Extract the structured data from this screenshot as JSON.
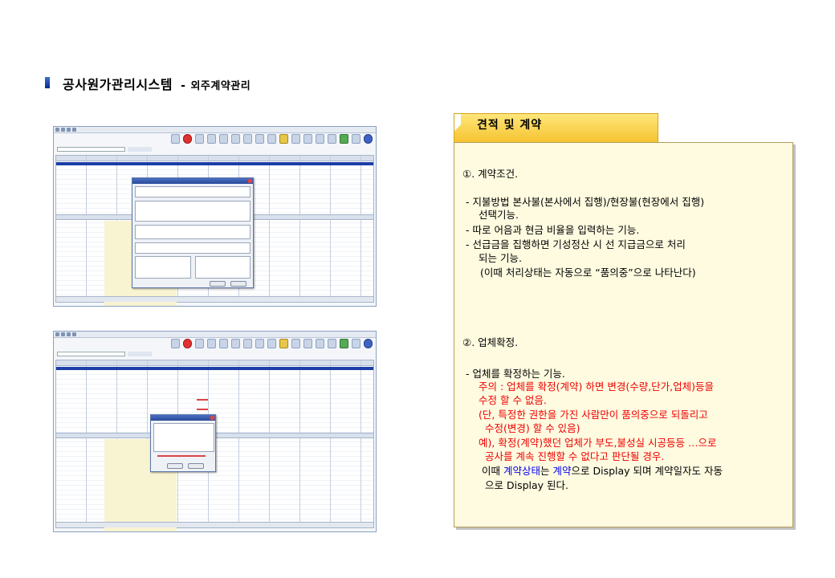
{
  "page": {
    "title_main": "공사원가관리시스템",
    "title_dash": "-",
    "title_sub": "외주계약관리"
  },
  "section": {
    "tab_label": "견적 및 계약"
  },
  "content": {
    "part1": {
      "heading": "①. 계약조건.",
      "lines": [
        "- 지불방법 본사불(본사에서 집행)/현장불(현장에서 집행)",
        "선택기능.",
        "- 따로 어음과 현금 비율을 입력하는 기능.",
        "- 선급금을 집행하면 기성정산 시 선 지급금으로 처리",
        "되는 기능.",
        "(이때 처리상태는 자동으로 “품의중”으로 나타난다)"
      ]
    },
    "part2": {
      "heading": "②. 업체확정.",
      "intro": "- 업체를 확정하는 기능.",
      "red_lines": [
        "주의 : 업체를 확정(계약) 하면 변경(수량,단가,업체)등을",
        "수정 할 수 없음.",
        "(단, 특정한 권한을 가진 사람만이 품의중으로 되돌리고",
        "수정(변경) 할 수 있음)",
        "예), 확정(계약)했던 업체가 부도,불성실 시공등등 …으로",
        "공사를 계속 진행할 수 없다고 판단될 경우."
      ],
      "final": {
        "a": "이때 ",
        "b": "계약상태",
        "c": "는 ",
        "d": "계약",
        "e": "으로 Display 되며 계약일자도 자동",
        "f": "으로 Display 된다."
      }
    }
  },
  "colors": {
    "tab_fill": "#f5c431",
    "panel_fill": "#fffbe0",
    "accent_red": "#ee0000",
    "accent_blue": "#0000ee",
    "title_marker": "#0a2e8a"
  },
  "screenshots": [
    {
      "id": "contract-conditions-screen",
      "icon": "app-window-screenshot"
    },
    {
      "id": "vendor-confirm-screen",
      "icon": "app-window-screenshot"
    }
  ]
}
